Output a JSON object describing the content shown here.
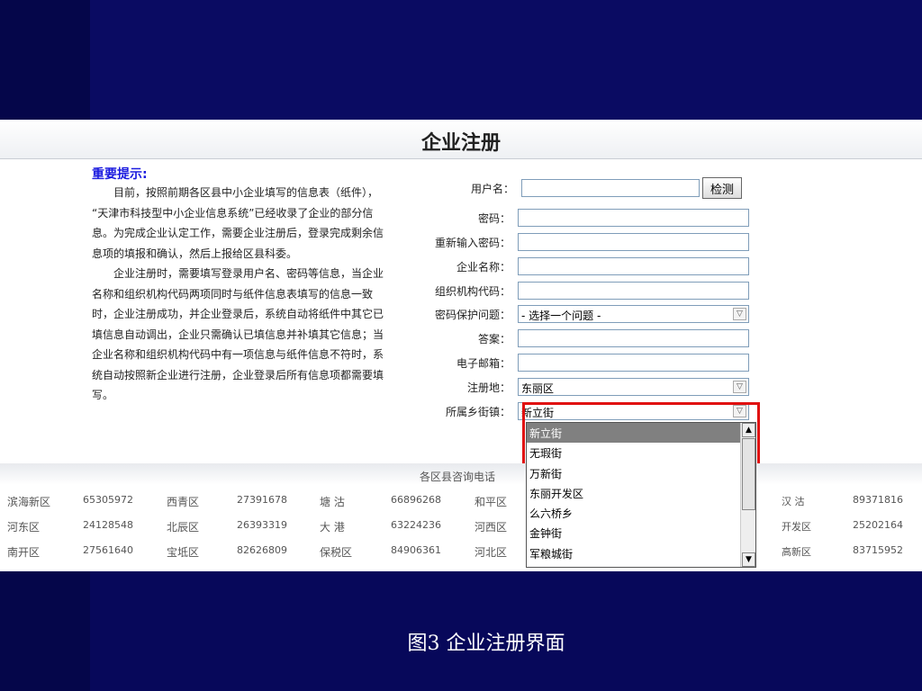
{
  "page": {
    "title": "企业注册",
    "caption": "图3 企业注册界面"
  },
  "notice": {
    "heading": "重要提示:",
    "p1": "目前，按照前期各区县中小企业填写的信息表（纸件）， “天津市科技型中小企业信息系统”已经收录了企业的部分信息。为完成企业认定工作，需要企业注册后，登录完成剩余信息项的填报和确认，然后上报给区县科委。",
    "p2": "企业注册时，需要填写登录用户名、密码等信息，当企业名称和组织机构代码两项同时与纸件信息表填写的信息一致时，企业注册成功，并企业登录后，系统自动将纸件中其它已填信息自动调出，企业只需确认已填信息并补填其它信息；当企业名称和组织机构代码中有一项信息与纸件信息不符时，系统自动按照新企业进行注册，企业登录后所有信息项都需要填写。"
  },
  "form": {
    "username": {
      "label": "用户名：",
      "value": "",
      "check_button": "检测"
    },
    "fields": [
      {
        "label": "密码：",
        "value": ""
      },
      {
        "label": "重新输入密码：",
        "value": ""
      },
      {
        "label": "企业名称：",
        "value": ""
      },
      {
        "label": "组织机构代码：",
        "value": ""
      },
      {
        "label": "密码保护问题：",
        "value": "- 选择一个问题 -",
        "select": true
      },
      {
        "label": "答案：",
        "value": ""
      },
      {
        "label": "电子邮箱：",
        "value": ""
      },
      {
        "label": "注册地：",
        "value": "东丽区",
        "select": true
      },
      {
        "label": "所属乡街镇：",
        "value": "新立街",
        "select": true
      }
    ],
    "dropdown_options": [
      "新立街",
      "无瑕街",
      "万新街",
      "东丽开发区",
      "么六桥乡",
      "金钟街",
      "军粮城街"
    ],
    "dropdown_selected": "新立街"
  },
  "phones": {
    "title": "各区县咨询电话",
    "rows": [
      [
        "滨海新区",
        "65305972",
        "西青区",
        "27391678",
        "塘 沽",
        "66896268",
        "和平区",
        "汉 沽",
        "89371816"
      ],
      [
        "河东区",
        "24128548",
        "北辰区",
        "26393319",
        "大 港",
        "63224236",
        "河西区",
        "开发区",
        "25202164"
      ],
      [
        "南开区",
        "27561640",
        "宝坻区",
        "82626809",
        "保税区",
        "84906361",
        "河北区",
        "高新区",
        "83715952"
      ]
    ]
  },
  "colors": {
    "highlight": "#e01010",
    "heading": "#1a1adf",
    "background": "#07085a"
  }
}
